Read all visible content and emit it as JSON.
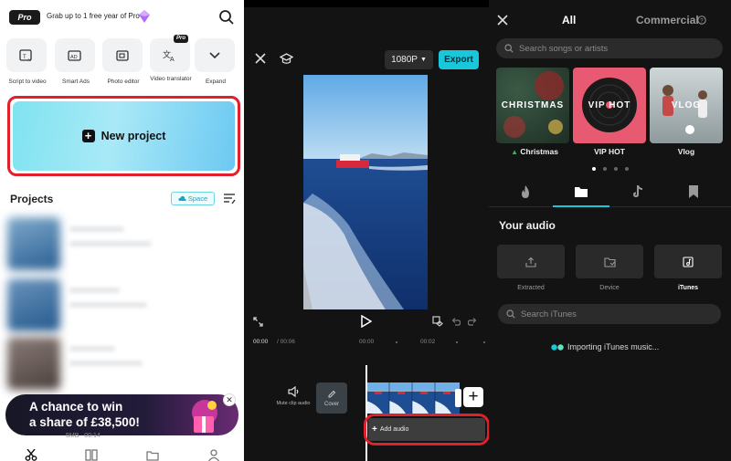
{
  "home": {
    "pro_badge": "Pro",
    "promo": "Grab up to 1 free year of Pro",
    "tools": [
      {
        "label": "Script to video",
        "icon": "script-icon"
      },
      {
        "label": "Smart Ads",
        "icon": "ads-icon"
      },
      {
        "label": "Photo editor",
        "icon": "photo-editor-icon"
      },
      {
        "label": "Video translator",
        "icon": "translate-icon",
        "badge": "Pro"
      },
      {
        "label": "Expand",
        "icon": "chevron-down-icon"
      }
    ],
    "new_project": "New project",
    "projects_title": "Projects",
    "space_chip": "Space",
    "banner_line1": "A chance to win",
    "banner_line2": "a share of £38,500!",
    "project_meta": "5MB",
    "project_duration": "00:14"
  },
  "editor": {
    "resolution": "1080P",
    "export": "Export",
    "time_current": "00:00",
    "time_total": "/ 00:06",
    "ticks": [
      "00:00",
      "00:02"
    ],
    "mute_label": "Mute clip audio",
    "cover_label": "Cover",
    "add_audio": "Add audio"
  },
  "music": {
    "tab_all": "All",
    "tab_commercial": "Commercial",
    "search_placeholder": "Search songs or artists",
    "cards": [
      {
        "title": "CHRISTMAS",
        "name": "Christmas"
      },
      {
        "title": "VIP HOT",
        "name": "VIP HOT"
      },
      {
        "title": "VLOG",
        "name": "Vlog"
      }
    ],
    "your_audio": "Your audio",
    "sources": [
      "Extracted",
      "Device",
      "iTunes"
    ],
    "selected_source": "iTunes",
    "itunes_search": "Search iTunes",
    "importing": "Importing iTunes music...",
    "colors": {
      "accent": "#18c7d9",
      "highlight": "#e0202a"
    }
  }
}
